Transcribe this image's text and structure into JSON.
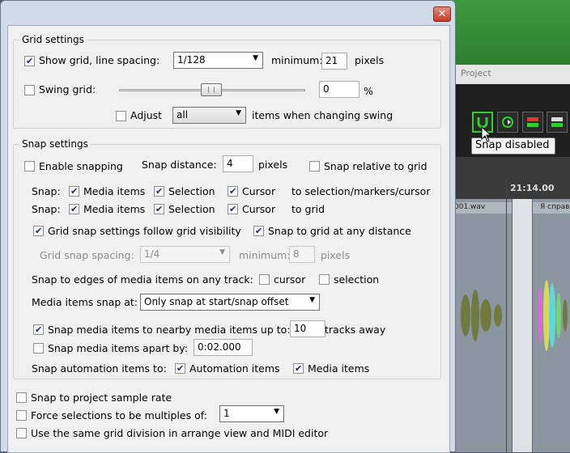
{
  "background": {
    "menu_fragment": "Project",
    "tooltip": "Snap disabled",
    "ruler_time": "21:14.00",
    "track_left_label": "001.wav",
    "track_right_label": "Я справ",
    "colors": {
      "accent_green": "#2fd12f",
      "title_green": "#3e9a3e"
    }
  },
  "dialog": {
    "close_glyph": "✕",
    "grid_settings": {
      "title": "Grid settings",
      "show_grid": {
        "label": "Show grid, line spacing:",
        "checked": true
      },
      "line_spacing": "1/128",
      "minimum_label": "minimum:",
      "minimum_value": "21",
      "pixels_label": "pixels",
      "swing_grid": {
        "label": "Swing grid:",
        "checked": false
      },
      "swing_value": "0",
      "percent": "%",
      "adjust": {
        "label": "Adjust",
        "checked": false
      },
      "adjust_select": "all",
      "adjust_suffix": "items when changing swing"
    },
    "snap_settings": {
      "title": "Snap settings",
      "enable_snapping": {
        "label": "Enable snapping",
        "checked": false
      },
      "snap_distance_label": "Snap distance:",
      "snap_distance_value": "4",
      "pixels_label": "pixels",
      "snap_relative": {
        "label": "Snap relative to grid",
        "checked": false
      },
      "snap_row1": {
        "label": "Snap:",
        "media_items": "Media items",
        "selection": "Selection",
        "cursor": "Cursor",
        "suffix": "to selection/markers/cursor"
      },
      "snap_row2": {
        "label": "Snap:",
        "media_items": "Media items",
        "selection": "Selection",
        "cursor": "Cursor",
        "suffix": "to grid"
      },
      "grid_follow": {
        "label": "Grid snap settings follow grid visibility",
        "checked": true
      },
      "snap_any_distance": {
        "label": "Snap to grid at any distance",
        "checked": true
      },
      "grid_snap_spacing_label": "Grid snap spacing:",
      "grid_snap_spacing_value": "1/4",
      "grid_min_label": "minimum:",
      "grid_min_value": "8",
      "grid_pixels_label": "pixels",
      "edges_label": "Snap to edges of media items on any track:",
      "edges_cursor": "cursor",
      "edges_selection": "selection",
      "media_snap_at_label": "Media items snap at:",
      "media_snap_at_value": "Only snap at start/snap offset",
      "snap_nearby": {
        "label": "Snap media items to nearby media items up to:",
        "checked": true
      },
      "nearby_value": "10",
      "tracks_away": "tracks away",
      "snap_apart": {
        "label": "Snap media items apart by:",
        "checked": false
      },
      "apart_value": "0:02.000",
      "automation_label": "Snap automation items to:",
      "automation_items": "Automation items",
      "automation_media": "Media items"
    },
    "bottom": {
      "project_rate": {
        "label": "Snap to project sample rate",
        "checked": false
      },
      "force_multiples": {
        "label": "Force selections to be multiples of:",
        "checked": false
      },
      "multiples_value": "1",
      "same_grid": {
        "label": "Use the same grid division in arrange view and MIDI editor",
        "checked": false
      }
    }
  }
}
